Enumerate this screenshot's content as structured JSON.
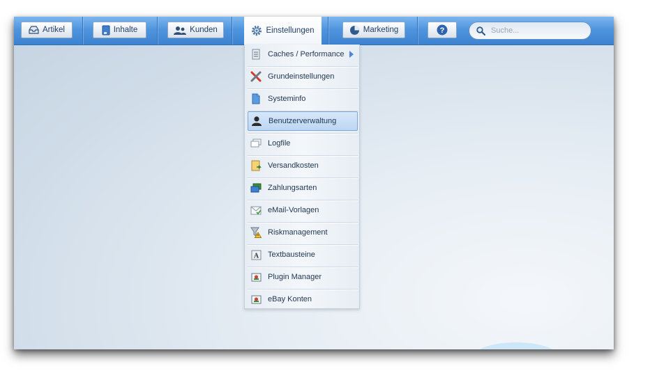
{
  "toolbar": {
    "buttons": [
      {
        "label": "Artikel",
        "icon": "box-icon"
      },
      {
        "label": "Inhalte",
        "icon": "document-icon"
      },
      {
        "label": "Kunden",
        "icon": "users-icon"
      },
      {
        "label": "Einstellungen",
        "icon": "gear-icon"
      },
      {
        "label": "Marketing",
        "icon": "pie-chart-icon"
      },
      {
        "label": "",
        "icon": "help-icon"
      }
    ],
    "search": {
      "placeholder": "Suche...",
      "value": ""
    }
  },
  "menu": {
    "items": [
      {
        "label": "Caches / Performance",
        "icon": "cache-icon",
        "has_submenu": true
      },
      {
        "label": "Grundeinstellungen",
        "icon": "tools-icon"
      },
      {
        "label": "Systeminfo",
        "icon": "page-icon"
      },
      {
        "label": "Benutzerverwaltung",
        "icon": "user-icon",
        "highlighted": true
      },
      {
        "label": "Logfile",
        "icon": "log-icon"
      },
      {
        "label": "Versandkosten",
        "icon": "shipping-icon"
      },
      {
        "label": "Zahlungsarten",
        "icon": "payment-icon"
      },
      {
        "label": "eMail-Vorlagen",
        "icon": "mail-icon"
      },
      {
        "label": "Riskmanagement",
        "icon": "risk-icon"
      },
      {
        "label": "Textbausteine",
        "icon": "text-icon"
      },
      {
        "label": "Plugin Manager",
        "icon": "plugin-icon"
      },
      {
        "label": "eBay Konten",
        "icon": "ebay-icon"
      }
    ]
  },
  "colors": {
    "toolbar": "#4f95de",
    "highlight": "#bcd6f3",
    "text": "#1f3550"
  }
}
